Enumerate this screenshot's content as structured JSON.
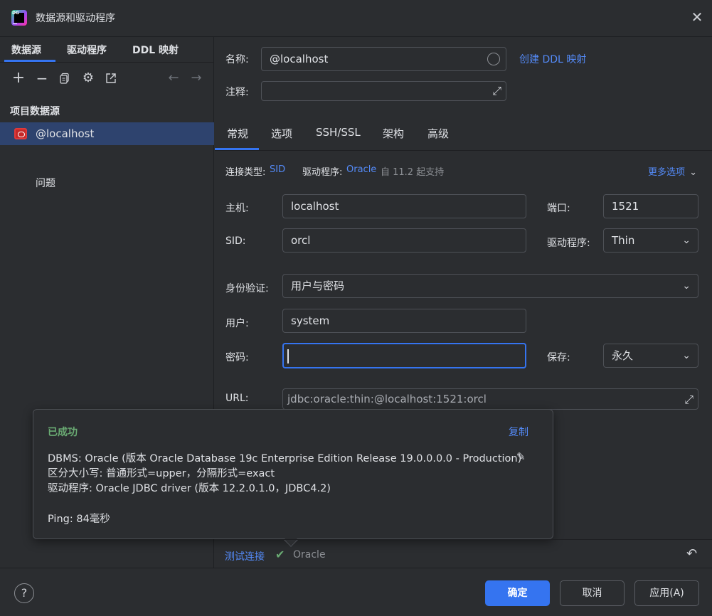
{
  "window": {
    "logo_text": "DG",
    "title": "数据源和驱动程序",
    "close_icon": "close-icon"
  },
  "left": {
    "tabs": [
      {
        "label": "数据源",
        "active": true
      },
      {
        "label": "驱动程序",
        "active": false
      },
      {
        "label": "DDL 映射",
        "active": false
      }
    ],
    "toolbar": [
      "add-icon",
      "remove-icon",
      "duplicate-icon",
      "settings-icon",
      "open-external-icon",
      "back-arrow-icon",
      "forward-arrow-icon"
    ],
    "section_title": "项目数据源",
    "datasources": [
      {
        "label": "@localhost",
        "icon": "oracle-icon",
        "selected": true
      }
    ],
    "problems_label": "问题"
  },
  "header": {
    "name_label": "名称:",
    "name_value": "@localhost",
    "create_ddl_link": "创建 DDL 映射",
    "comment_label": "注释:",
    "comment_value": ""
  },
  "tabs": [
    {
      "label": "常规",
      "active": true
    },
    {
      "label": "选项",
      "active": false
    },
    {
      "label": "SSH/SSL",
      "active": false
    },
    {
      "label": "架构",
      "active": false
    },
    {
      "label": "高级",
      "active": false
    }
  ],
  "general": {
    "conn_type_label": "连接类型:",
    "conn_type_value": "SID",
    "driver_label": "驱动程序:",
    "driver_value": "Oracle",
    "driver_note": "自 11.2 起支持",
    "more_options": "更多选项",
    "host_label": "主机:",
    "host_value": "localhost",
    "port_label": "端口:",
    "port_value": "1521",
    "sid_label": "SID:",
    "sid_value": "orcl",
    "driver2_label": "驱动程序:",
    "driver2_value": "Thin",
    "auth_label": "身份验证:",
    "auth_value": "用户与密码",
    "user_label": "用户:",
    "user_value": "system",
    "password_label": "密码:",
    "password_value": "",
    "save_label": "保存:",
    "save_value": "永久",
    "url_label": "URL:",
    "url_value": "jdbc:oracle:thin:@localhost:1521:orcl"
  },
  "popup": {
    "status": "已成功",
    "copy": "复制",
    "lines": [
      "DBMS: Oracle (版本 Oracle Database 19c Enterprise Edition Release 19.0.0.0.0 - Production)",
      "区分大小写: 普通形式=upper，分隔形式=exact",
      "驱动程序: Oracle JDBC driver (版本 12.2.0.1.0，JDBC4.2)",
      "Ping: 84毫秒"
    ]
  },
  "test": {
    "link": "测试连接",
    "check_icon": "check-icon",
    "result": "Oracle",
    "revert_icon": "revert-icon"
  },
  "footer": {
    "help": "?",
    "ok": "确定",
    "cancel": "取消",
    "apply": "应用(A)"
  },
  "colors": {
    "accent": "#3574f0",
    "link": "#548af7",
    "success": "#6aab73",
    "background": "#2b2d30",
    "selection": "#2e436e"
  }
}
